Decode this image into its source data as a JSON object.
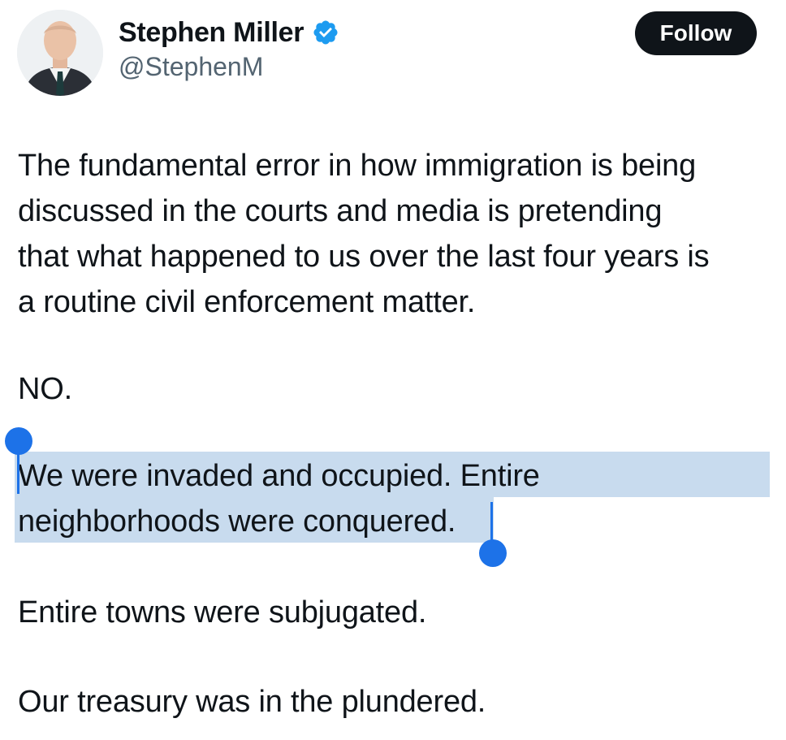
{
  "author": {
    "display_name": "Stephen Miller",
    "handle": "@StephenM",
    "verified": true,
    "verified_color": "#1d9bf0"
  },
  "actions": {
    "follow_label": "Follow"
  },
  "tweet": {
    "paragraph_1_lines": [
      "The fundamental error in how immigration is being",
      "discussed in the courts and media is pretending",
      "that what happened to us over the last four years is",
      "a routine civil enforcement matter."
    ],
    "paragraph_2": "NO.",
    "paragraph_3_lines": [
      "We were invaded and occupied. Entire",
      "neighborhoods were conquered."
    ],
    "paragraph_4": "Entire towns were subjugated.",
    "paragraph_5": "Our treasury was in the plundered."
  },
  "selection": {
    "highlight_color": "#c8dbee",
    "handle_color": "#1d72e8"
  }
}
